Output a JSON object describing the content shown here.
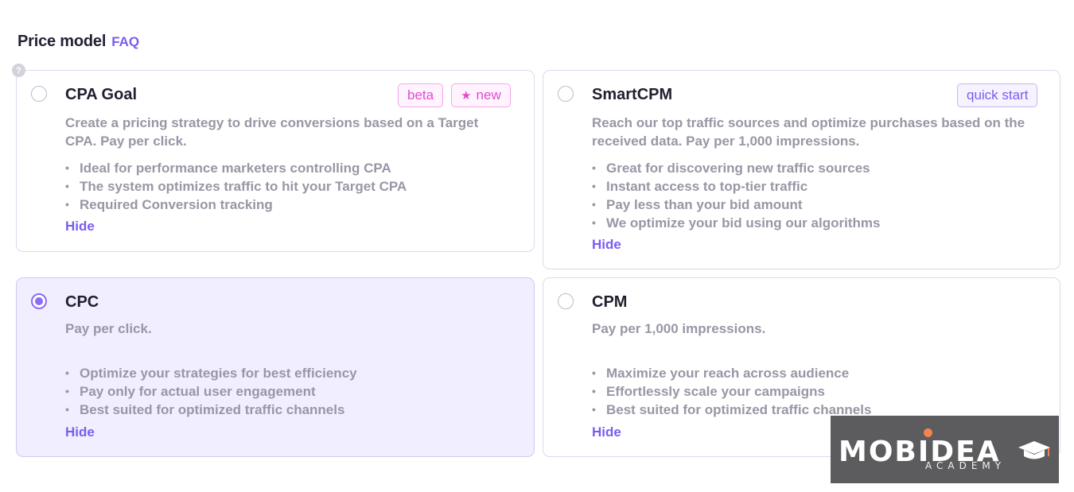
{
  "header": {
    "title": "Price model",
    "faq_label": "FAQ",
    "help_icon": "?"
  },
  "cards": {
    "cpa_goal": {
      "title": "CPA Goal",
      "selected": false,
      "badges": [
        {
          "label": "beta"
        },
        {
          "icon": "★",
          "label": "new"
        }
      ],
      "description": "Create a pricing strategy to drive conversions based on a Target CPA. Pay per click.",
      "features": [
        "Ideal for performance marketers controlling CPA",
        "The system optimizes traffic to hit your Target CPA",
        "Required Conversion tracking"
      ],
      "hide_label": "Hide"
    },
    "smartcpm": {
      "title": "SmartCPM",
      "selected": false,
      "badges": [
        {
          "label": "quick start"
        }
      ],
      "description": "Reach our top traffic sources and optimize purchases based on the received data. Pay per 1,000 impressions.",
      "features": [
        "Great for discovering new traffic sources",
        "Instant access to top-tier traffic",
        "Pay less than your bid amount",
        "We optimize your bid using our algorithms"
      ],
      "hide_label": "Hide"
    },
    "cpc": {
      "title": "CPC",
      "selected": true,
      "description": "Pay per click.",
      "features": [
        "Optimize your strategies for best efficiency",
        "Pay only for actual user engagement",
        "Best suited for optimized traffic channels"
      ],
      "hide_label": "Hide"
    },
    "cpm": {
      "title": "CPM",
      "selected": false,
      "description": "Pay per 1,000 impressions.",
      "features": [
        "Maximize your reach across audience",
        "Effortlessly scale your campaigns",
        "Best suited for optimized traffic channels"
      ],
      "hide_label": "Hide"
    }
  },
  "watermark": {
    "brand": "MOBIDEA",
    "sub": "ACADEMY"
  },
  "colors": {
    "accent": "#7b5cf0",
    "radio_selected": "#8b6cf5",
    "selected_card_bg": "#f1efff",
    "badge_pink": "#e04bd3",
    "muted_text": "#9797a6"
  }
}
